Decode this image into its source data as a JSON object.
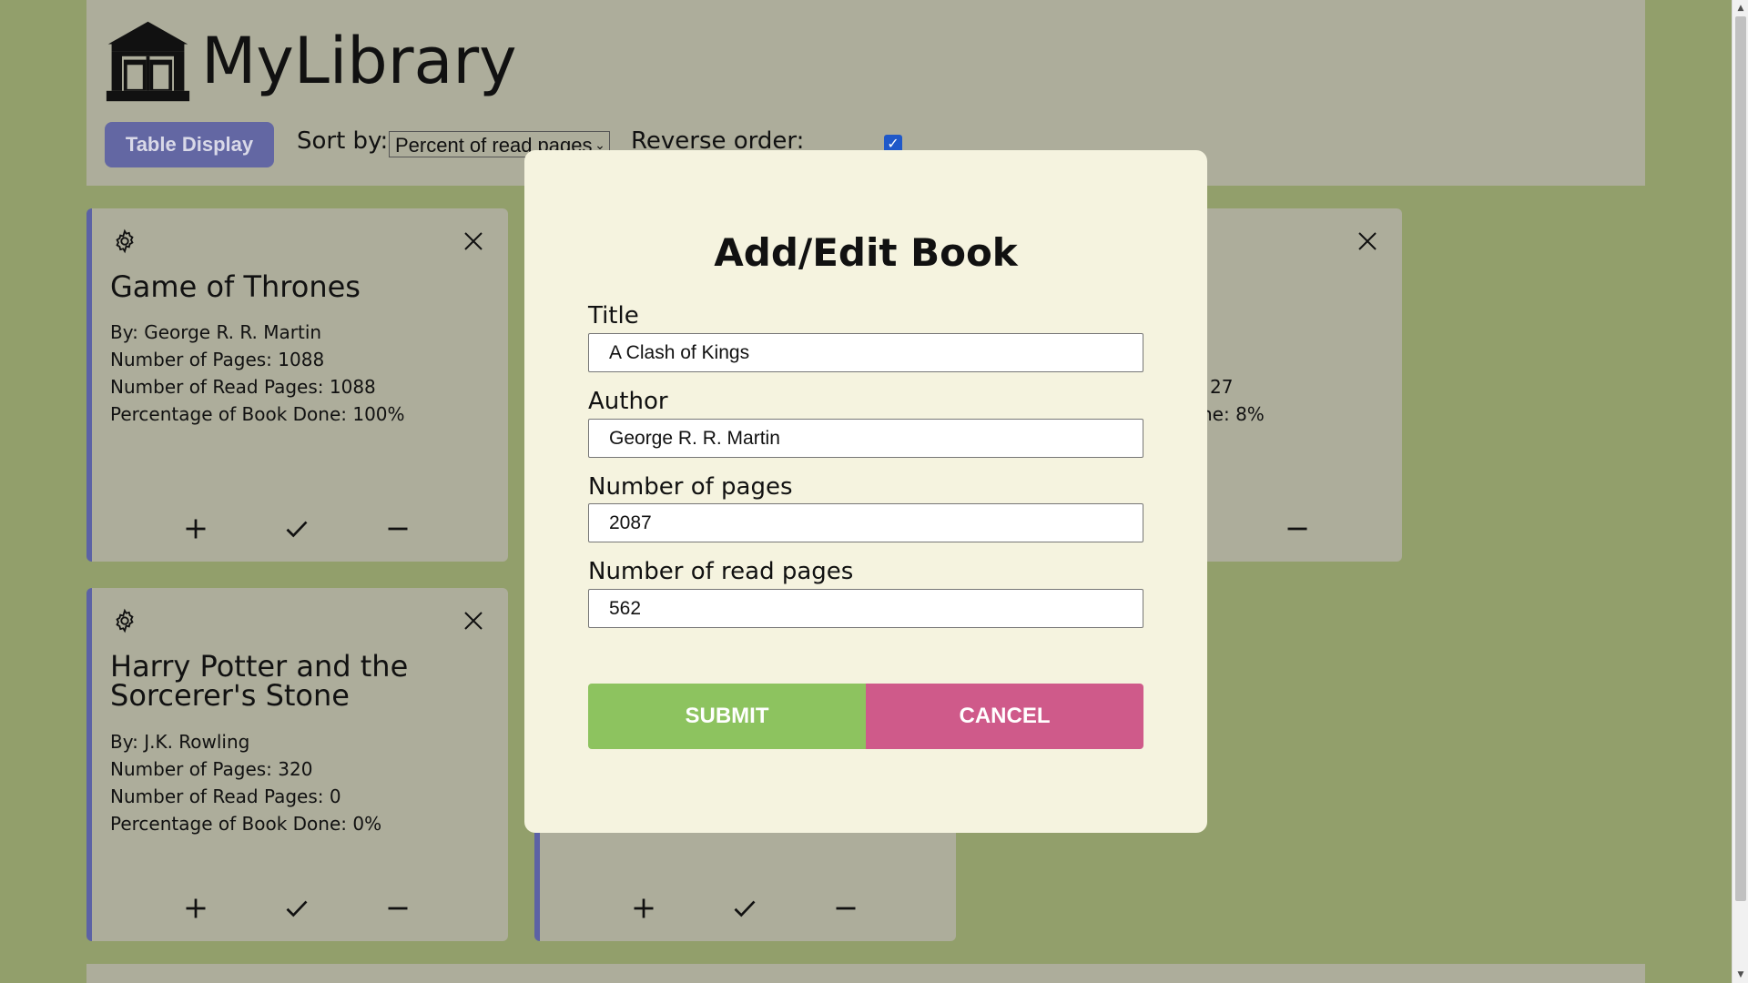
{
  "app": {
    "title": "MyLibrary",
    "logo_icon": "library-building-icon"
  },
  "toolbar": {
    "table_display_label": "Table Display",
    "sort_label": "Sort by:",
    "sort_value": "Percent of read pages",
    "reverse_label": "Reverse order:",
    "reverse_checked": true
  },
  "cards": [
    {
      "title": "Game of Thrones",
      "author": "By: George R. R. Martin",
      "pages": "Number of Pages: 1088",
      "read_pages": "Number of Read Pages: 1088",
      "percent": "Percentage of Book Done: 100%"
    },
    {
      "partial_read_pages": "27",
      "partial_percent": "ne: 8%"
    },
    {
      "title": "Harry Potter and the Sorcerer's Stone",
      "author": "By: J.K. Rowling",
      "pages": "Number of Pages: 320",
      "read_pages": "Number of Read Pages: 0",
      "percent": "Percentage of Book Done: 0%"
    }
  ],
  "modal": {
    "title": "Add/Edit Book",
    "fields": {
      "title_label": "Title",
      "title_value": "A Clash of Kings",
      "author_label": "Author",
      "author_value": "George R. R. Martin",
      "pages_label": "Number of pages",
      "pages_value": "2087",
      "read_label": "Number of read pages",
      "read_value": "562"
    },
    "submit_label": "SUBMIT",
    "cancel_label": "CANCEL"
  },
  "colors": {
    "background": "#929f6b",
    "panel": "#adad9b",
    "accent": "#6367a3",
    "modal": "#f5f3df",
    "submit": "#8dc35f",
    "cancel": "#cf5a8a"
  }
}
